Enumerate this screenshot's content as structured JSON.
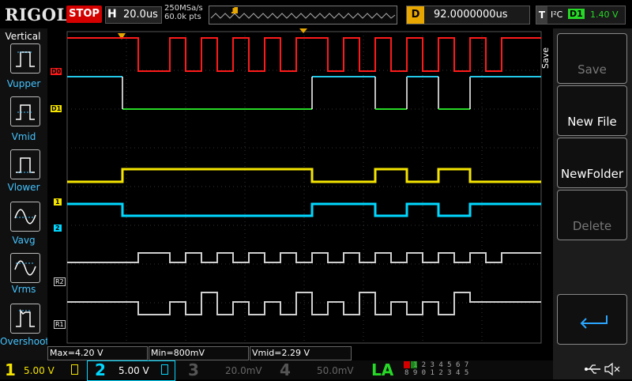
{
  "header": {
    "brand": "RIGOL",
    "run_state": "STOP",
    "timebase_label": "H",
    "timebase_value": "20.0us",
    "sample_rate": "250MSa/s",
    "memory_depth": "60.0k pts",
    "trigger_marker": "T",
    "delay_label": "D",
    "delay_value": "92.0000000us",
    "trigger_label": "T",
    "trigger_type": "I²C",
    "trigger_source": "D1",
    "trigger_level": "1.40 V"
  },
  "left_menu": {
    "title": "Vertical",
    "items": [
      {
        "label": "Vupper",
        "icon": "vupper-icon"
      },
      {
        "label": "Vmid",
        "icon": "vmid-icon"
      },
      {
        "label": "Vlower",
        "icon": "vlower-icon"
      },
      {
        "label": "Vavg",
        "icon": "vavg-icon"
      },
      {
        "label": "Vrms",
        "icon": "vrms-icon"
      },
      {
        "label": "Overshoot",
        "icon": "overshoot-icon"
      }
    ]
  },
  "right_menu": {
    "title": "Save",
    "items": [
      {
        "label": "Save",
        "enabled": false
      },
      {
        "label": "New File",
        "enabled": true
      },
      {
        "label": "NewFolder",
        "enabled": true
      },
      {
        "label": "Delete",
        "enabled": false
      },
      {
        "label": "",
        "icon": "return-arrow-icon",
        "enabled": true
      }
    ]
  },
  "channel_markers": {
    "d0": "D0",
    "d1": "D1",
    "ch1": "1",
    "ch2": "2",
    "r2": "R2",
    "r1": "R1"
  },
  "measurements": {
    "max": "Max=4.20 V",
    "min": "Min=800mV",
    "vmid": "Vmid=2.29 V"
  },
  "bottom_bar": {
    "ch1": {
      "num": "1",
      "scale": "5.00 V",
      "color": "#f5e400"
    },
    "ch2": {
      "num": "2",
      "scale": "5.00 V",
      "color": "#00d8ff"
    },
    "ch3": {
      "num": "3",
      "scale": "20.0mV",
      "color": "#555555"
    },
    "ch4": {
      "num": "4",
      "scale": "50.0mV",
      "color": "#555555"
    },
    "la": "LA",
    "la_row1": "0 1 2 3  4 5 6 7",
    "la_row2": "8 9 0 1  2 3 4 5",
    "usb_icon": "usb-icon",
    "mute_icon": "mute-icon"
  },
  "colors": {
    "d0": "#ff1a1a",
    "d1_high": "#22c8e8",
    "d1_low": "#27d927",
    "ch1": "#f5e400",
    "ch2": "#00d8ff",
    "ref": "#cfcfcf",
    "accent_blue": "#2aa6ff",
    "delay_orange": "#e7a700"
  }
}
